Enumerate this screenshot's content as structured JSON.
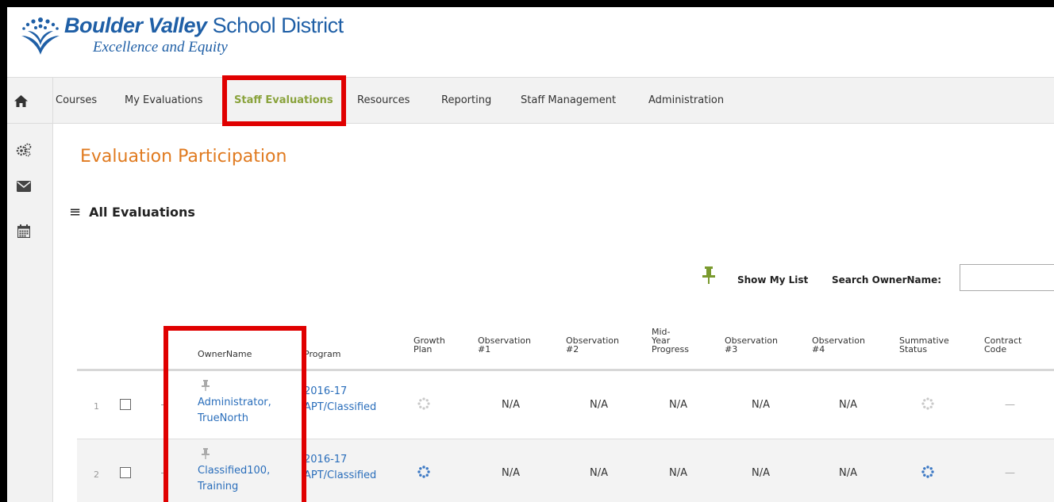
{
  "header": {
    "brand_bold": "Boulder Valley",
    "brand_light": "School District",
    "tagline": "Excellence and Equity"
  },
  "nav": {
    "home_icon": "home-icon",
    "items": [
      {
        "label": "Courses"
      },
      {
        "label": "My Evaluations"
      },
      {
        "label": "Staff Evaluations",
        "active": true
      },
      {
        "label": "Resources"
      },
      {
        "label": "Reporting"
      },
      {
        "label": "Staff Management"
      },
      {
        "label": "Administration"
      }
    ]
  },
  "rail": {
    "icons": [
      "gears-icon",
      "envelope-icon",
      "calendar-icon"
    ]
  },
  "page": {
    "title": "Evaluation Participation",
    "section": "All Evaluations",
    "show_my_list": "Show My List",
    "search_label": "Search OwnerName:",
    "search_value": ""
  },
  "table": {
    "headers": {
      "owner": "OwnerName",
      "program": "Program",
      "growth": "Growth\nPlan",
      "obs1": "Observation\n#1",
      "obs2": "Observation\n#2",
      "midyear": "Mid-\nYear\nProgress",
      "obs3": "Observation\n#3",
      "obs4": "Observation\n#4",
      "summative": "Summative\nStatus",
      "contract": "Contract\nCode"
    },
    "rows": [
      {
        "num": "1",
        "owner_line1": "Administrator,",
        "owner_line2": "TrueNorth",
        "program_line1": "2016-17",
        "program_line2": "APT/Classified",
        "obs1": "N/A",
        "obs2": "N/A",
        "midyear": "N/A",
        "obs3": "N/A",
        "obs4": "N/A",
        "contract": "—"
      },
      {
        "num": "2",
        "owner_line1": "Classified100,",
        "owner_line2": "Training",
        "program_line1": "2016-17",
        "program_line2": "APT/Classified",
        "obs1": "N/A",
        "obs2": "N/A",
        "midyear": "N/A",
        "obs3": "N/A",
        "obs4": "N/A",
        "contract": "—"
      }
    ]
  },
  "colors": {
    "brand_blue": "#1f5fa6",
    "title_orange": "#e07a1f",
    "active_green": "#8aa33d",
    "pin_green": "#7a9a2e",
    "link_blue": "#2a6ebb",
    "highlight_red": "#e00000"
  }
}
